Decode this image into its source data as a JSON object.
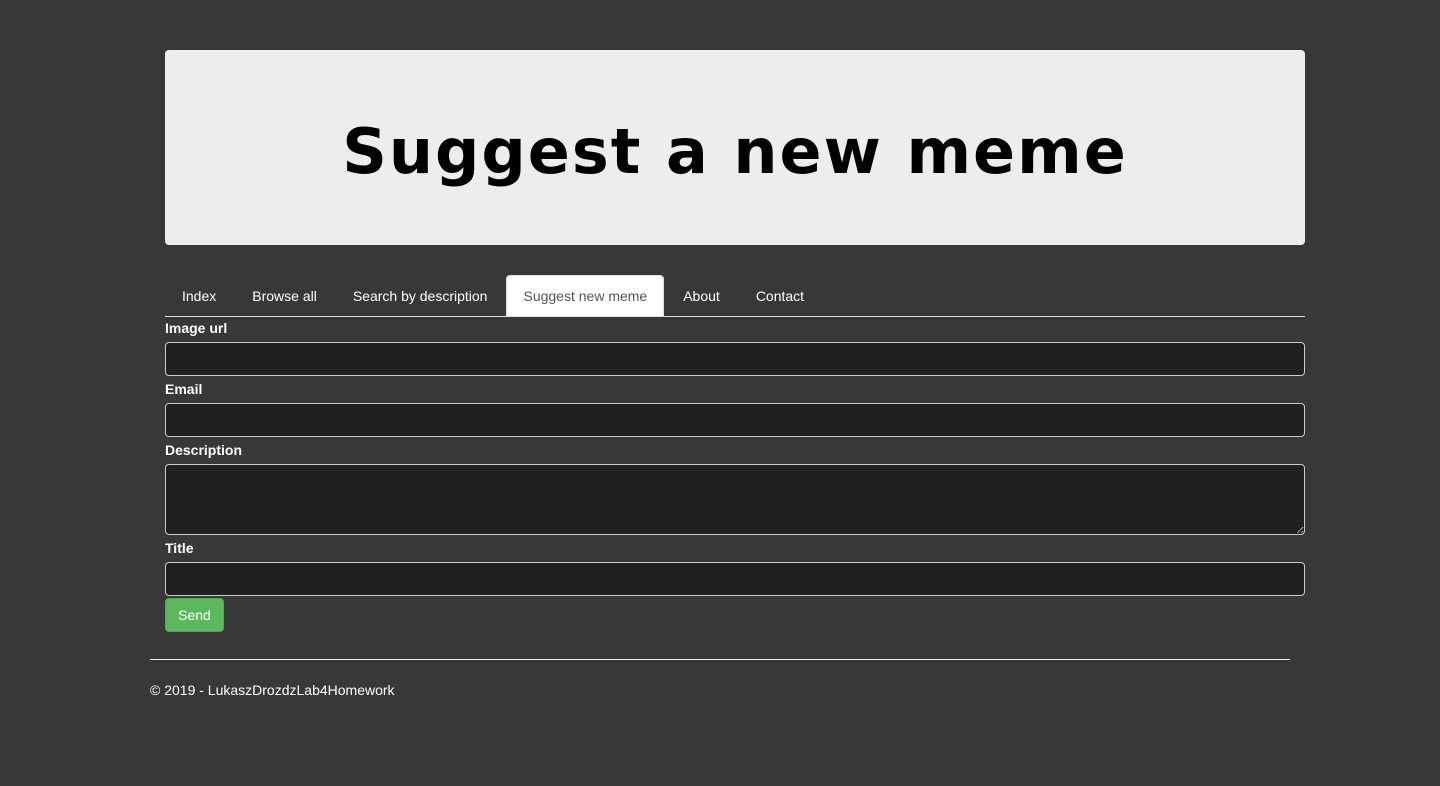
{
  "header": {
    "title": "Suggest a new meme"
  },
  "nav": {
    "tabs": [
      {
        "label": "Index",
        "active": false
      },
      {
        "label": "Browse all",
        "active": false
      },
      {
        "label": "Search by description",
        "active": false
      },
      {
        "label": "Suggest new meme",
        "active": true
      },
      {
        "label": "About",
        "active": false
      },
      {
        "label": "Contact",
        "active": false
      }
    ]
  },
  "form": {
    "image_url": {
      "label": "Image url",
      "value": ""
    },
    "email": {
      "label": "Email",
      "value": ""
    },
    "description": {
      "label": "Description",
      "value": ""
    },
    "title": {
      "label": "Title",
      "value": ""
    },
    "send_label": "Send"
  },
  "footer": {
    "text": "© 2019 - LukaszDrozdzLab4Homework"
  },
  "colors": {
    "background": "#383838",
    "jumbotron": "#ededed",
    "input_bg": "#202020",
    "send_button": "#5cb85c"
  }
}
